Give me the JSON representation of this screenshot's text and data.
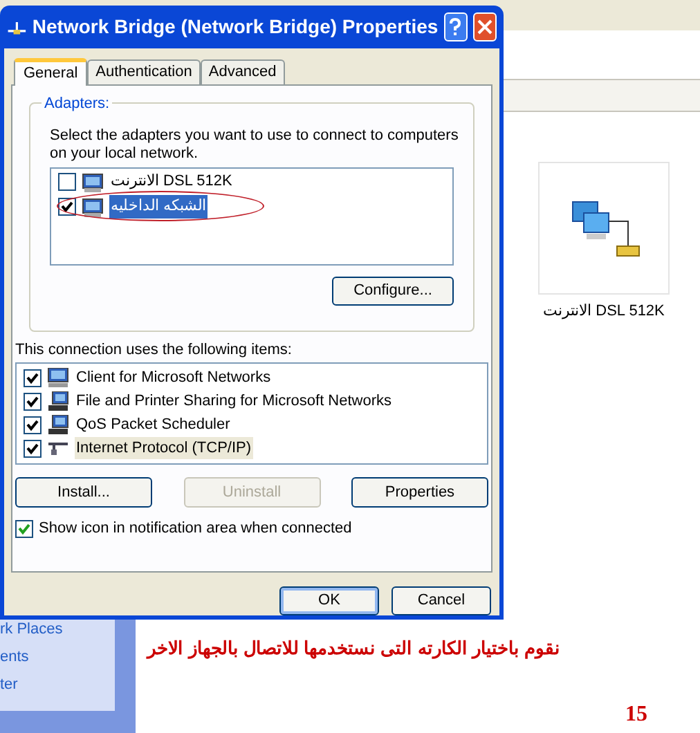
{
  "window": {
    "title": "Network Bridge (Network Bridge) Properties"
  },
  "tabs": [
    {
      "label": "General",
      "selected": true
    },
    {
      "label": "Authentication",
      "selected": false
    },
    {
      "label": "Advanced",
      "selected": false
    }
  ],
  "adapters": {
    "group_label": "Adapters:",
    "description": "Select the adapters you want to use to connect to computers on your local network.",
    "items": [
      {
        "label": "الانترنت DSL 512K",
        "checked": false,
        "selected": false
      },
      {
        "label": "الشبكه الداخليه",
        "checked": true,
        "selected": true
      }
    ],
    "configure_button": "Configure..."
  },
  "items_label": "This connection uses the following items:",
  "items": [
    {
      "label": "Client for Microsoft Networks",
      "checked": true,
      "selected": false,
      "kind": "client"
    },
    {
      "label": "File and Printer Sharing for Microsoft Networks",
      "checked": true,
      "selected": false,
      "kind": "service"
    },
    {
      "label": "QoS Packet Scheduler",
      "checked": true,
      "selected": false,
      "kind": "service"
    },
    {
      "label": "Internet Protocol (TCP/IP)",
      "checked": true,
      "selected": true,
      "kind": "protocol"
    }
  ],
  "item_buttons": [
    {
      "label": "Install...",
      "disabled": false
    },
    {
      "label": "Uninstall",
      "disabled": true
    },
    {
      "label": "Properties",
      "disabled": false
    }
  ],
  "notification_checkbox": {
    "label": "Show icon in notification area when connected",
    "checked": true
  },
  "dialog_buttons": [
    {
      "label": "OK",
      "default": true
    },
    {
      "label": "Cancel",
      "default": false
    }
  ],
  "background": {
    "sidebar_items": [
      "rk Places",
      "ents",
      "ter"
    ],
    "desktop_icon_label": "الانترنت DSL 512K",
    "caption": "نقوم باختيار الكارته التى نستخدمها للاتصال بالجهاز الاخر",
    "page_number": "15"
  }
}
